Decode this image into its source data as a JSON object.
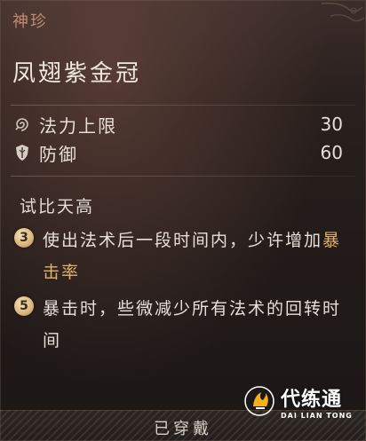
{
  "header": {
    "category": "神珍",
    "item_name": "凤翅紫金冠"
  },
  "stats": [
    {
      "icon": "spiral-icon",
      "label": "法力上限",
      "value": "30"
    },
    {
      "icon": "shield-icon",
      "label": "防御",
      "value": "60"
    }
  ],
  "set_bonus": {
    "name": "试比天高",
    "effects": [
      {
        "count": "3",
        "text_before": "使出法术后一段时间内，少许增加",
        "highlight": "暴击率",
        "text_after": ""
      },
      {
        "count": "5",
        "text_before": "暴击时，些微减少所有法术的回转时间",
        "highlight": "",
        "text_after": ""
      }
    ]
  },
  "footer": {
    "status_label": "已穿戴"
  },
  "watermark": {
    "cn": "代练通",
    "en": "DAI LIAN TONG"
  },
  "colors": {
    "category": "#c08b72",
    "highlight": "#e3b26a",
    "badge": "#d9b57a"
  }
}
